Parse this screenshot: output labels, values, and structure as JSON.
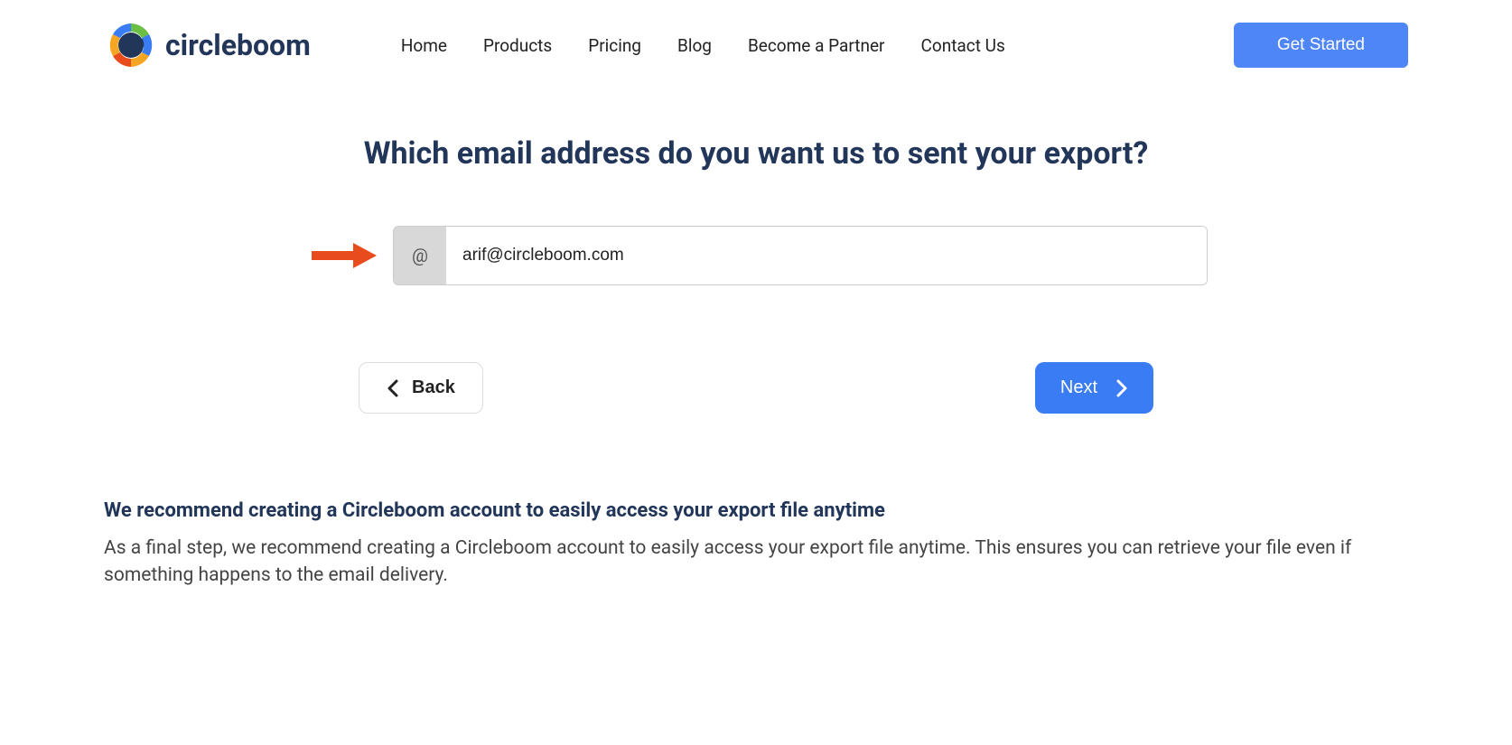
{
  "logo": {
    "text": "circleboom"
  },
  "nav": {
    "home": "Home",
    "products": "Products",
    "pricing": "Pricing",
    "blog": "Blog",
    "partner": "Become a Partner",
    "contact": "Contact Us"
  },
  "cta": {
    "get_started": "Get Started"
  },
  "form": {
    "heading": "Which email address do you want us to sent your export?",
    "prefix": "@",
    "email_value": "arif@circleboom.com",
    "back_label": "Back",
    "next_label": "Next"
  },
  "recommend": {
    "title": "We recommend creating a Circleboom account to easily access your export file anytime",
    "body": "As a final step, we recommend creating a Circleboom account to easily access your export file anytime. This ensures you can retrieve your file even if something happens to the email delivery."
  }
}
